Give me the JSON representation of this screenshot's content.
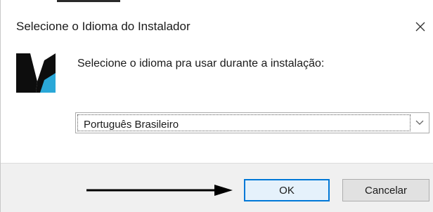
{
  "dialog": {
    "title": "Selecione o Idioma do Instalador",
    "close_icon": "close-icon"
  },
  "content": {
    "logo_icon": "installer-logo-icon",
    "prompt": "Selecione o idioma pra usar durante a instalação:",
    "language_select": {
      "selected": "Português Brasileiro",
      "arrow_icon": "chevron-down-icon"
    }
  },
  "footer": {
    "ok_label": "OK",
    "cancel_label": "Cancelar",
    "annotation_icon": "arrow-right-icon"
  },
  "colors": {
    "focus_border": "#0078d7",
    "footer_bg": "#f0f0f0",
    "logo_dark": "#0d0d0d",
    "logo_accent": "#2aa8d8"
  }
}
